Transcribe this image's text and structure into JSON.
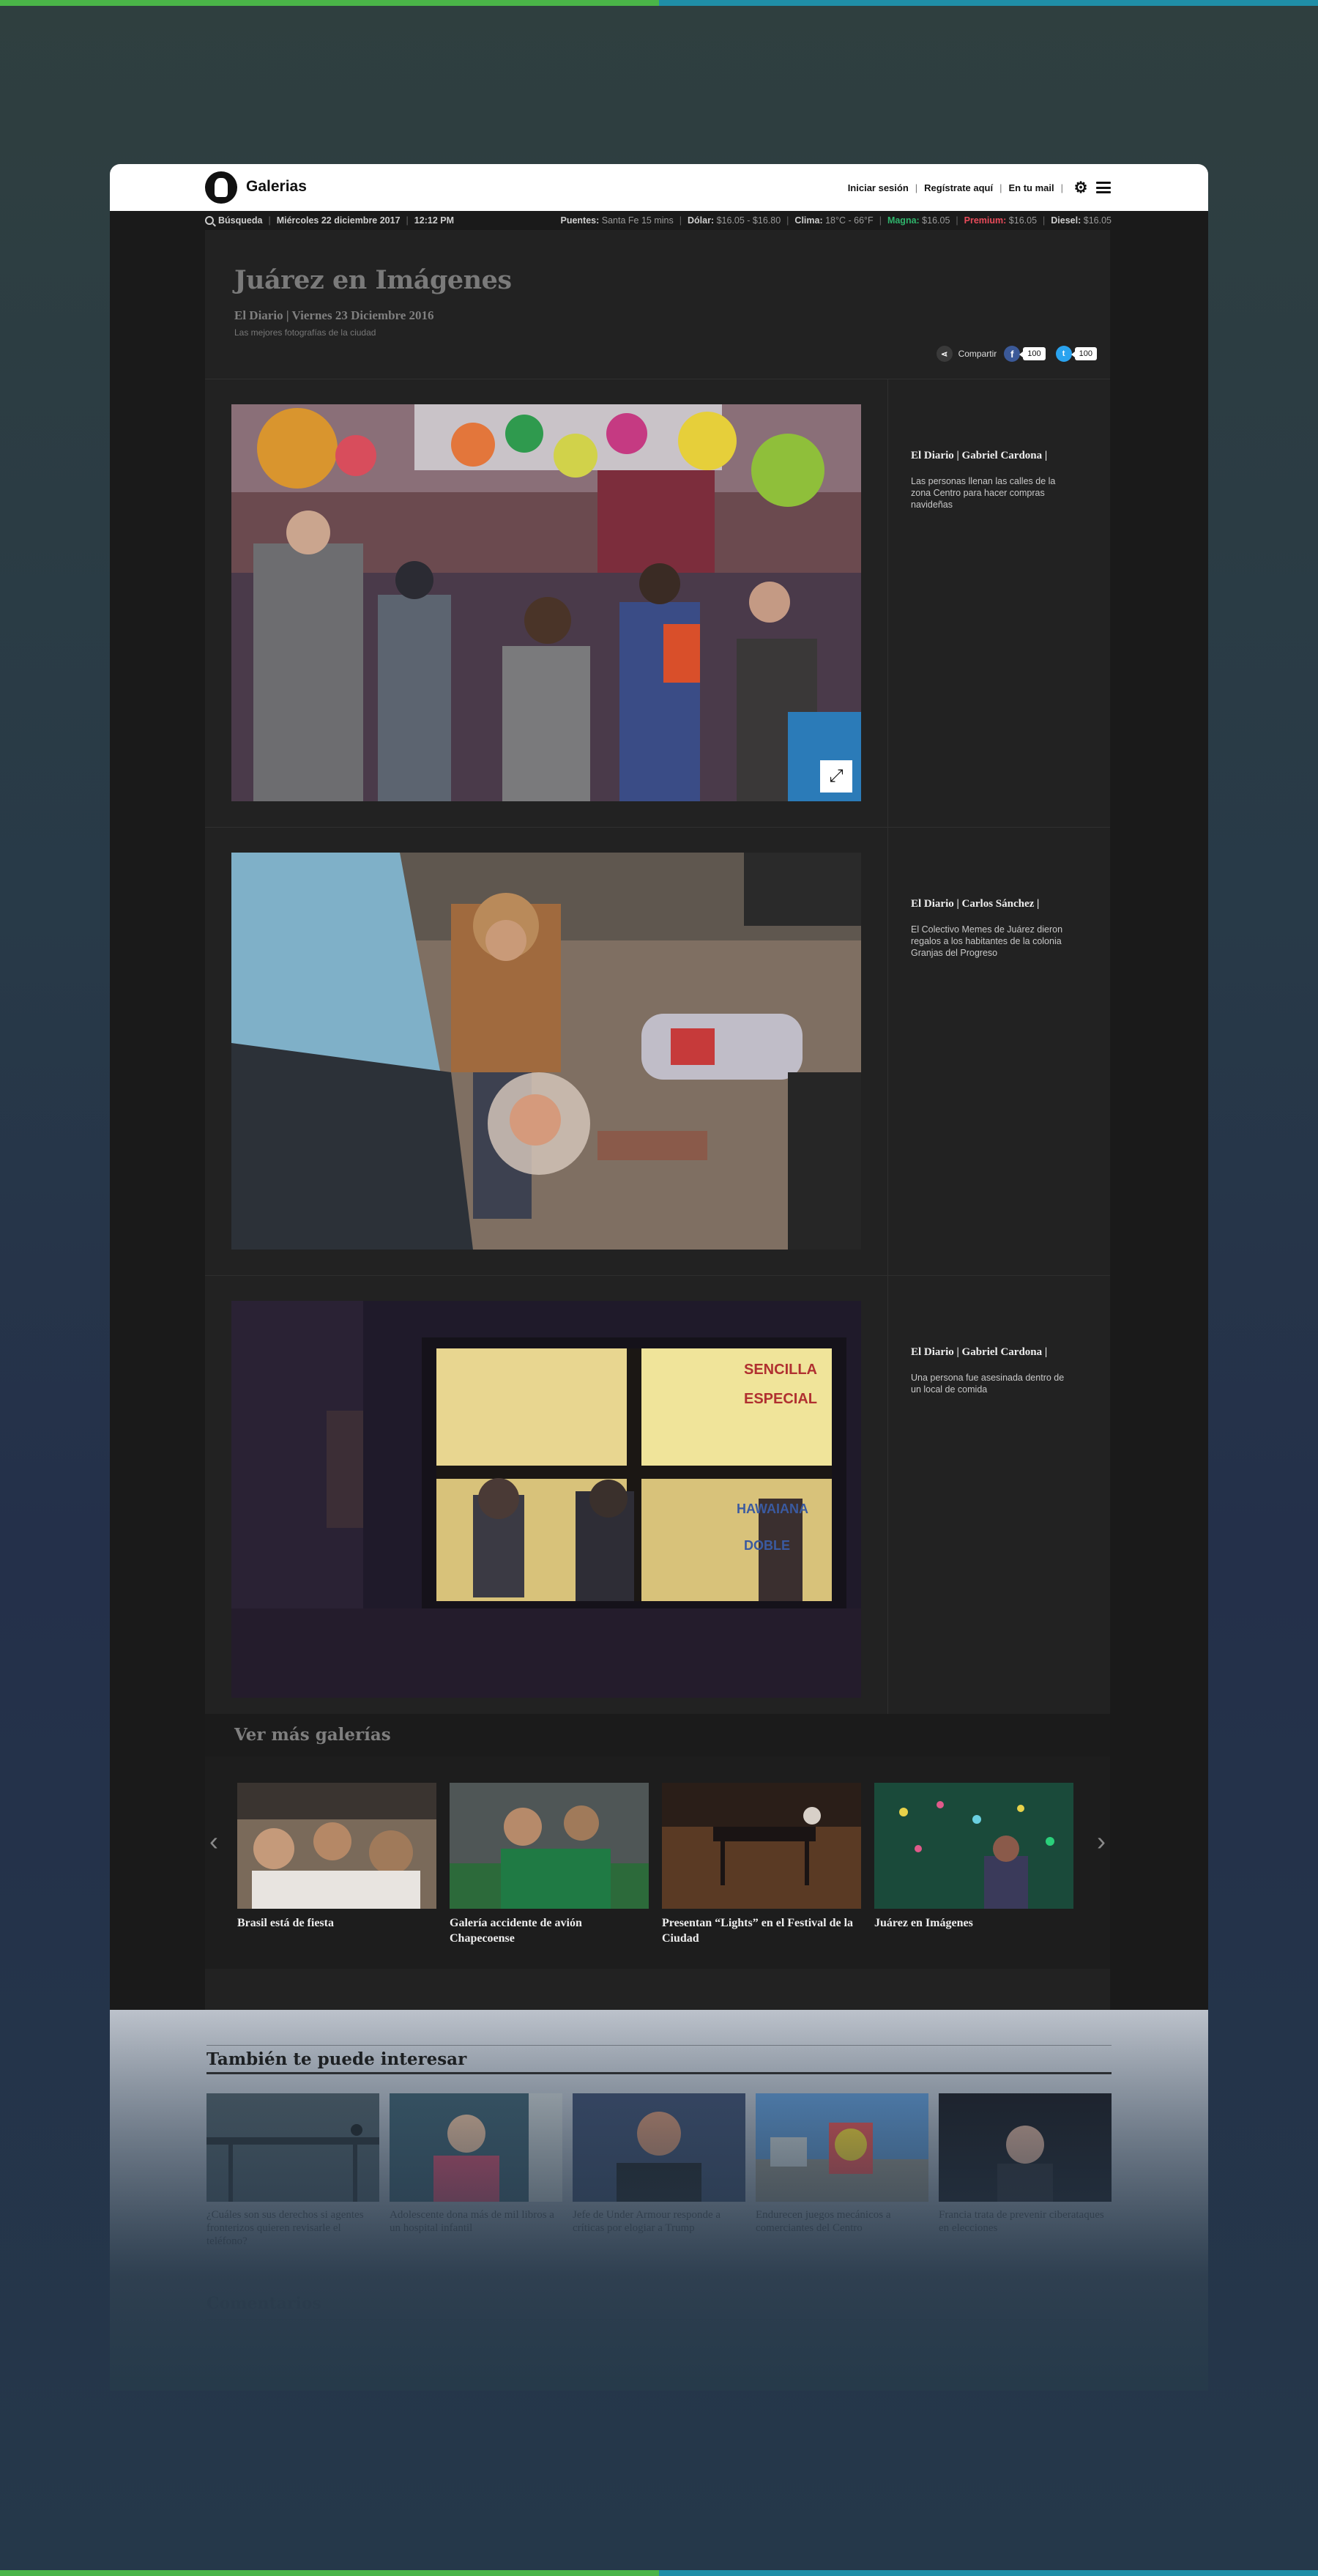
{
  "header": {
    "brand": "Galerias",
    "nav": [
      "Iniciar sesión",
      "Regístrate aquí",
      "En tu mail"
    ]
  },
  "ticker": {
    "search": "Búsqueda",
    "date": "Miércoles 22 diciembre 2017",
    "time": "12:12 PM",
    "items": [
      {
        "label": "Puentes:",
        "value": "Santa Fe 15 mins"
      },
      {
        "label": "Dólar:",
        "value": "$16.05 - $16.80"
      },
      {
        "label": "Clima:",
        "value": "18°C - 66°F"
      },
      {
        "label": "Magna:",
        "value": "$16.05",
        "color": "#2fb36b"
      },
      {
        "label": "Premium:",
        "value": "$16.05",
        "color": "#e84b5a"
      },
      {
        "label": "Diesel:",
        "value": "$16.05"
      }
    ]
  },
  "gallery": {
    "title": "Juárez en Imágenes",
    "meta": "El Diario | Viernes 23 Diciembre 2016",
    "subtitle": "Las mejores fotografías de la ciudad",
    "share_label": "Compartir",
    "facebook_count": "100",
    "twitter_count": "100",
    "items": [
      {
        "credit": "El Diario | Gabriel Cardona |",
        "caption": "Las personas llenan las calles de la zona Centro para hacer compras navideñas"
      },
      {
        "credit": "El Diario | Carlos Sánchez |",
        "caption": "El Colectivo Memes de Juárez dieron regalos a los habitantes de la colonia Granjas del Progreso"
      },
      {
        "credit": "El Diario | Gabriel Cardona |",
        "caption": "Una persona fue asesinada dentro de un local de comida"
      }
    ]
  },
  "more": {
    "title": "Ver más galerías",
    "items": [
      {
        "title": "Brasil está de fiesta"
      },
      {
        "title": "Galería accidente de avión Chapecoense"
      },
      {
        "title": "Presentan “Lights” en el Festival de la Ciudad"
      },
      {
        "title": "Juárez en Imágenes"
      }
    ]
  },
  "related": {
    "title": "También te puede interesar",
    "items": [
      {
        "title": "¿Cuáles son sus derechos si agentes fronterizos quieren revisarle el teléfono?"
      },
      {
        "title": "Adolescente dona más de mil libros a un hospital infantil"
      },
      {
        "title": "Jefe de Under Armour responde a críticas por elogiar a Trump"
      },
      {
        "title": "Endurecen juegos mecánicos a comerciantes del Centro"
      },
      {
        "title": "Francia trata de prevenir ciberataques en elecciones"
      }
    ]
  },
  "comments": {
    "title": "Comentarios"
  },
  "colors": {
    "accent_green": "#4ab548",
    "accent_blue": "#1f8ea7",
    "magna": "#2fb36b",
    "premium": "#e84b5a",
    "facebook": "#3b5998",
    "twitter": "#2aa3ef"
  }
}
